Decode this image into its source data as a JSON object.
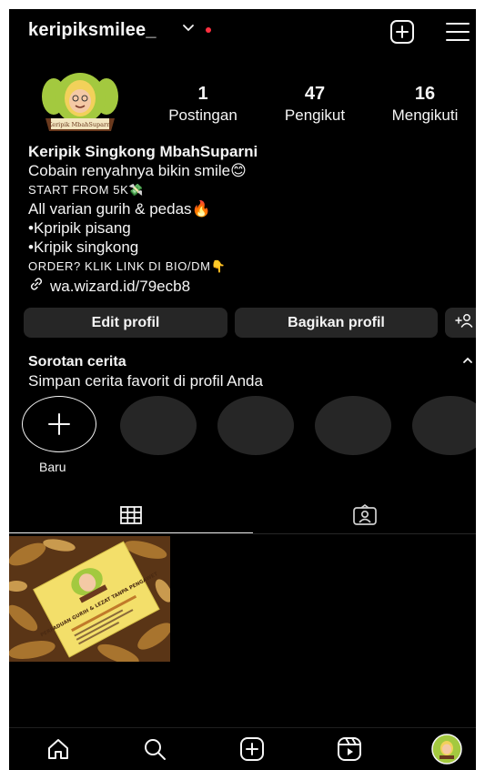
{
  "header": {
    "username": "keripiksmilee_",
    "chevron_icon": "chevron-down-icon",
    "notification_dot_color": "#ff3040",
    "add_icon": "plus-square-icon",
    "menu_icon": "hamburger-menu-icon"
  },
  "profile": {
    "stats": [
      {
        "value": "1",
        "label": "Postingan"
      },
      {
        "value": "47",
        "label": "Pengikut"
      },
      {
        "value": "16",
        "label": "Mengikuti"
      }
    ],
    "avatar_logo_text": "Keripik MbahSuparni"
  },
  "bio": {
    "name": "Keripik Singkong MbahSuparni",
    "lines": [
      "Cobain renyahnya bikin smile😊",
      "START FROM 5K💸",
      "All varian gurih & pedas🔥",
      "•Kpripik pisang",
      "•Kripik singkong",
      "ORDER? KLIK LINK DI BIO/DM👇"
    ],
    "link": "wa.wizard.id/79ecb8",
    "link_icon": "link-icon"
  },
  "buttons": {
    "edit_profile": "Edit profil",
    "share_profile": "Bagikan profil",
    "add_person_icon": "add-person-icon"
  },
  "highlights": {
    "title": "Sorotan cerita",
    "subtitle": "Simpan cerita favorit di profil Anda",
    "new_label": "Baru",
    "collapse_icon": "chevron-up-icon"
  },
  "tabs": {
    "grid_icon": "grid-icon",
    "tagged_icon": "tagged-person-icon"
  },
  "post": {
    "flyer_text": "PERPADUAN GURIH & LEZAT TANPA PENGAWET"
  },
  "bottom_nav": [
    "home-icon",
    "search-icon",
    "create-icon",
    "reels-icon",
    "profile-avatar"
  ],
  "colors": {
    "background": "#000000",
    "surface": "#262626",
    "text": "#f5f5f5",
    "accent_red": "#ff3040"
  }
}
